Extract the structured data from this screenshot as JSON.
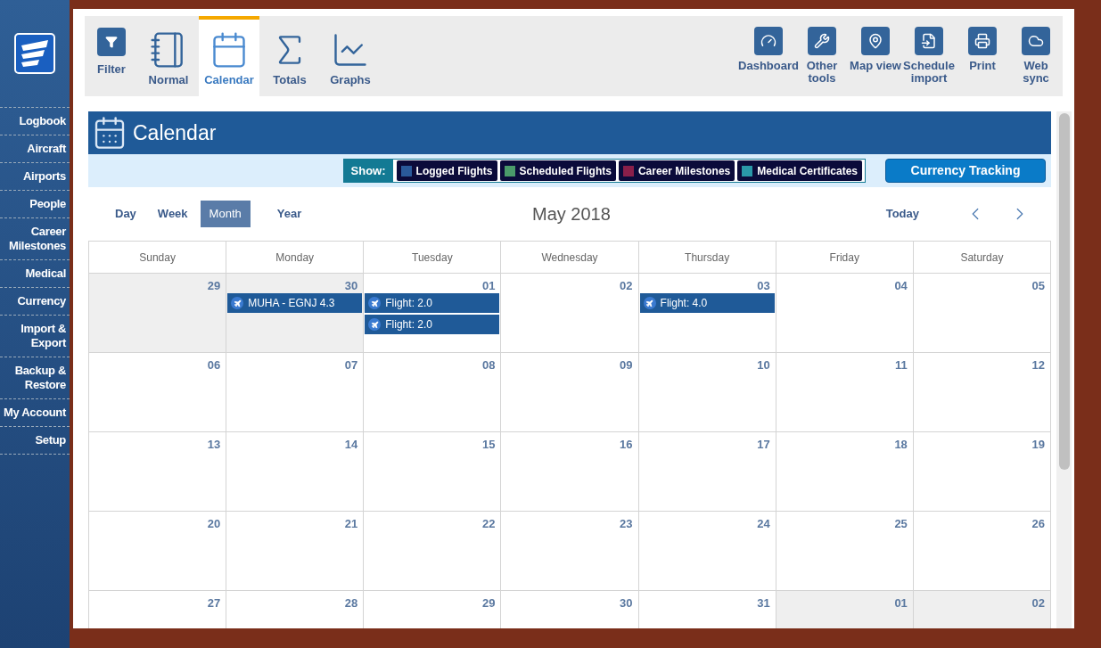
{
  "sidebar": {
    "items": [
      {
        "label": "Logbook"
      },
      {
        "label": "Aircraft"
      },
      {
        "label": "Airports"
      },
      {
        "label": "People"
      },
      {
        "label": "Career Milestones"
      },
      {
        "label": "Medical"
      },
      {
        "label": "Currency"
      },
      {
        "label": "Import & Export"
      },
      {
        "label": "Backup & Restore"
      },
      {
        "label": "My Account"
      },
      {
        "label": "Setup"
      }
    ]
  },
  "toolbar": {
    "filter": {
      "label": "Filter"
    },
    "tabs": [
      {
        "label": "Normal",
        "kind": "normal",
        "selected": false
      },
      {
        "label": "Calendar",
        "kind": "calendar",
        "selected": true
      },
      {
        "label": "Totals",
        "kind": "totals",
        "selected": false
      },
      {
        "label": "Graphs",
        "kind": "graphs",
        "selected": false
      }
    ],
    "tools": [
      {
        "label": "Dashboard",
        "kind": "dashboard"
      },
      {
        "label": "Other tools",
        "kind": "tools"
      },
      {
        "label": "Map view",
        "kind": "map"
      },
      {
        "label": "Schedule import",
        "kind": "import"
      },
      {
        "label": "Print",
        "kind": "print"
      },
      {
        "label": "Web sync",
        "kind": "cloud"
      }
    ]
  },
  "calendar": {
    "title": "Calendar",
    "show_label": "Show:",
    "legend": [
      {
        "label": "Logged Flights",
        "color": "#2a5a9a"
      },
      {
        "label": "Scheduled Flights",
        "color": "#4a9a6a"
      },
      {
        "label": "Career Milestones",
        "color": "#8a1f4a"
      },
      {
        "label": "Medical Certificates",
        "color": "#2a98a8"
      }
    ],
    "currency_button": "Currency Tracking",
    "views": [
      {
        "label": "Day",
        "selected": false
      },
      {
        "label": "Week",
        "selected": false
      },
      {
        "label": "Month",
        "selected": true
      },
      {
        "label": "Year",
        "selected": false
      }
    ],
    "month": "May 2018",
    "today": "Today",
    "weekdays": [
      "Sunday",
      "Monday",
      "Tuesday",
      "Wednesday",
      "Thursday",
      "Friday",
      "Saturday"
    ],
    "weeks": [
      {
        "days": [
          {
            "day": "29",
            "outside": true
          },
          {
            "day": "30",
            "outside": true,
            "events": [
              "MUHA - EGNJ 4.3"
            ]
          },
          {
            "day": "01",
            "outside": false,
            "events": [
              "Flight: 2.0",
              "Flight: 2.0"
            ]
          },
          {
            "day": "02",
            "outside": false
          },
          {
            "day": "03",
            "outside": false,
            "events": [
              "Flight: 4.0"
            ]
          },
          {
            "day": "04",
            "outside": false
          },
          {
            "day": "05",
            "outside": false
          }
        ]
      },
      {
        "days": [
          {
            "day": "06",
            "outside": false
          },
          {
            "day": "07",
            "outside": false
          },
          {
            "day": "08",
            "outside": false
          },
          {
            "day": "09",
            "outside": false
          },
          {
            "day": "10",
            "outside": false
          },
          {
            "day": "11",
            "outside": false
          },
          {
            "day": "12",
            "outside": false
          }
        ]
      },
      {
        "days": [
          {
            "day": "13",
            "outside": false
          },
          {
            "day": "14",
            "outside": false
          },
          {
            "day": "15",
            "outside": false
          },
          {
            "day": "16",
            "outside": false
          },
          {
            "day": "17",
            "outside": false
          },
          {
            "day": "18",
            "outside": false
          },
          {
            "day": "19",
            "outside": false
          }
        ]
      },
      {
        "days": [
          {
            "day": "20",
            "outside": false
          },
          {
            "day": "21",
            "outside": false
          },
          {
            "day": "22",
            "outside": false
          },
          {
            "day": "23",
            "outside": false
          },
          {
            "day": "24",
            "outside": false
          },
          {
            "day": "25",
            "outside": false
          },
          {
            "day": "26",
            "outside": false
          }
        ]
      },
      {
        "days": [
          {
            "day": "27",
            "outside": false
          },
          {
            "day": "28",
            "outside": false
          },
          {
            "day": "29",
            "outside": false
          },
          {
            "day": "30",
            "outside": false
          },
          {
            "day": "31",
            "outside": false
          },
          {
            "day": "01",
            "outside": true
          },
          {
            "day": "02",
            "outside": true
          }
        ]
      }
    ]
  }
}
